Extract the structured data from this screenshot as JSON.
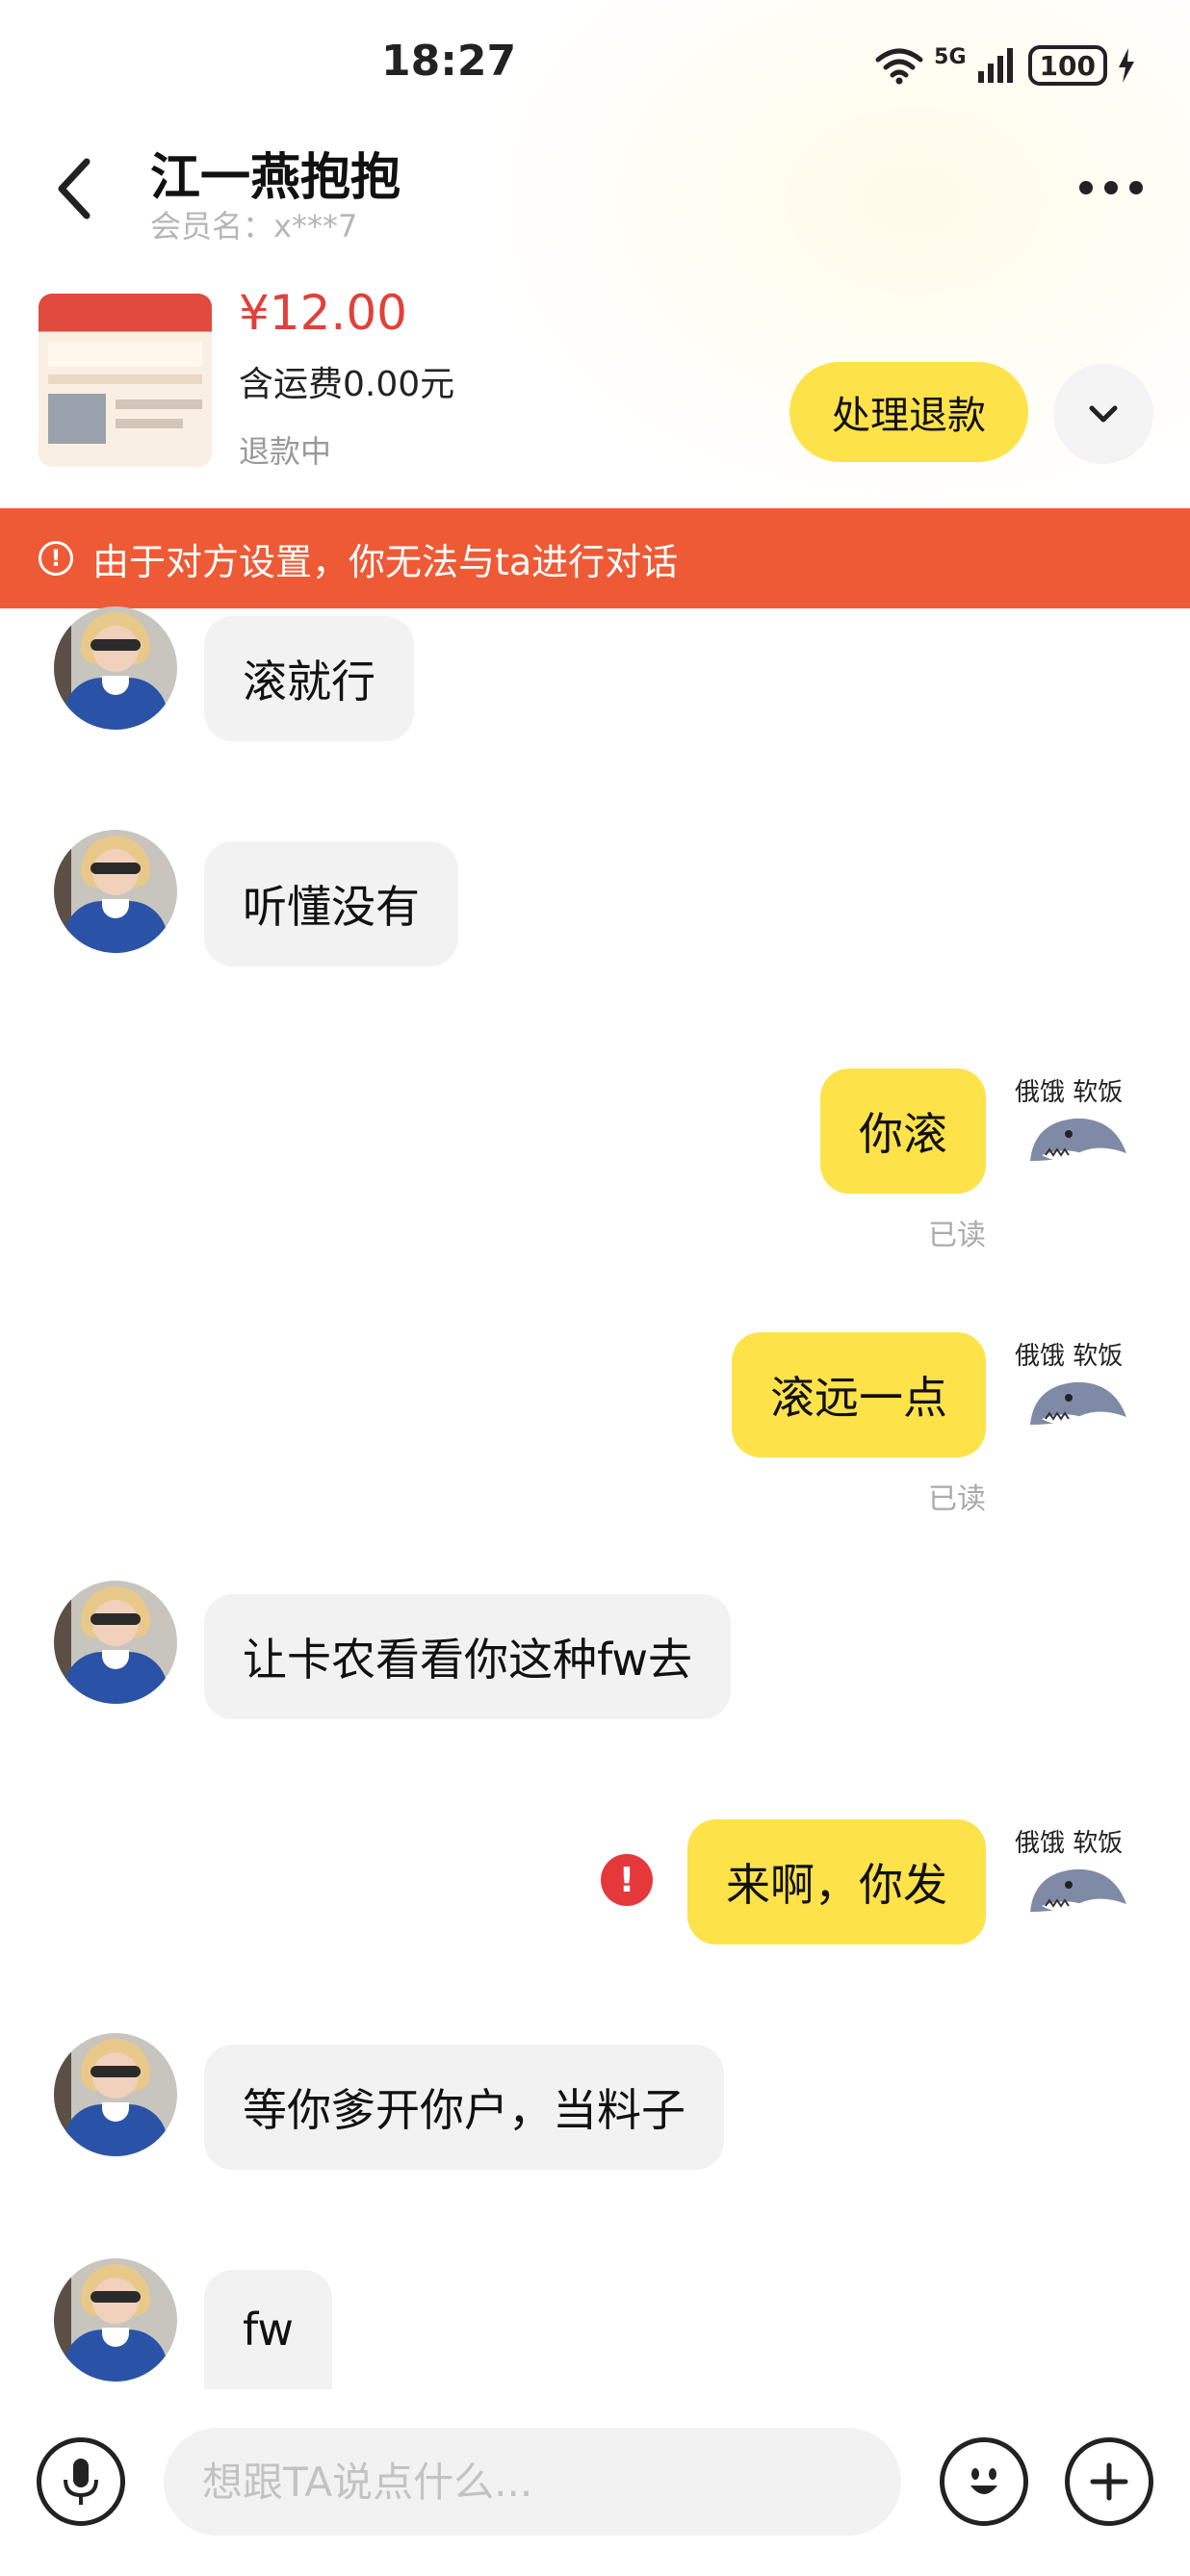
{
  "status_bar": {
    "time": "18:27",
    "network": "5G",
    "battery": "100"
  },
  "header": {
    "title": "江一燕抱抱",
    "member_label": "会员名：x***7"
  },
  "order": {
    "price": "¥12.00",
    "shipping": "含运费0.00元",
    "status": "退款中",
    "refund_button": "处理退款"
  },
  "banner": {
    "text": "由于对方设置，你无法与ta进行对话"
  },
  "messages": [
    {
      "side": "in",
      "text": "滚就行"
    },
    {
      "side": "in",
      "text": "听懂没有"
    },
    {
      "side": "out",
      "text": "你滚",
      "status": "已读",
      "sticker_caption": "俄饿 软饭"
    },
    {
      "side": "out",
      "text": "滚远一点",
      "status": "已读",
      "sticker_caption": "俄饿 软饭"
    },
    {
      "side": "in",
      "text": "让卡农看看你这种fw去"
    },
    {
      "side": "out",
      "text": "来啊，你发",
      "error": true,
      "sticker_caption": "俄饿 软饭"
    },
    {
      "side": "in",
      "text": "等你爹开你户，当料子"
    },
    {
      "side": "in",
      "text": "fw"
    }
  ],
  "input": {
    "placeholder": "想跟TA说点什么..."
  },
  "colors": {
    "accent_yellow": "#fee24a",
    "banner_orange": "#ee5a35",
    "price_red": "#e0413a"
  }
}
